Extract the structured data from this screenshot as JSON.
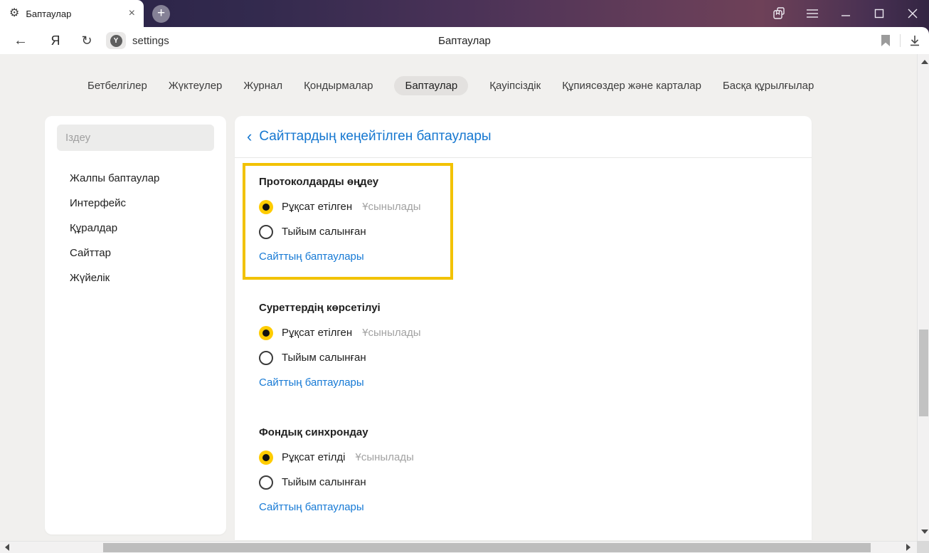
{
  "window": {
    "tab_title": "Баптаулар"
  },
  "toolbar": {
    "url": "settings",
    "page_title": "Баптаулар",
    "protect_letter": "Y"
  },
  "icons": {
    "gear": "⚙",
    "close": "×",
    "plus": "+",
    "back_arrow": "←",
    "refresh": "↻",
    "ya_logo": "Я",
    "back_chevron": "‹"
  },
  "nav": {
    "items": [
      {
        "label": "Бетбелгілер",
        "selected": false
      },
      {
        "label": "Жүктеулер",
        "selected": false
      },
      {
        "label": "Журнал",
        "selected": false
      },
      {
        "label": "Қондырмалар",
        "selected": false
      },
      {
        "label": "Баптаулар",
        "selected": true
      },
      {
        "label": "Қауіпсіздік",
        "selected": false
      },
      {
        "label": "Құпиясөздер және карталар",
        "selected": false
      },
      {
        "label": "Басқа құрылғылар",
        "selected": false
      }
    ]
  },
  "sidebar": {
    "search_placeholder": "Іздеу",
    "items": [
      {
        "label": "Жалпы баптаулар"
      },
      {
        "label": "Интерфейс"
      },
      {
        "label": "Құралдар"
      },
      {
        "label": "Сайттар"
      },
      {
        "label": "Жүйелік"
      }
    ]
  },
  "main": {
    "header": "Сайттардың кеңейтілген баптаулары",
    "sections": [
      {
        "title": "Протоколдарды өңдеу",
        "highlighted": true,
        "options": [
          {
            "label": "Рұқсат етілген",
            "selected": true,
            "badge": "Ұсынылады"
          },
          {
            "label": "Тыйым салынған",
            "selected": false,
            "badge": ""
          }
        ],
        "link": "Сайттың баптаулары"
      },
      {
        "title": "Суреттердің көрсетілуі",
        "highlighted": false,
        "options": [
          {
            "label": "Рұқсат етілген",
            "selected": true,
            "badge": "Ұсынылады"
          },
          {
            "label": "Тыйым салынған",
            "selected": false,
            "badge": ""
          }
        ],
        "link": "Сайттың баптаулары"
      },
      {
        "title": "Фондық синхрондау",
        "highlighted": false,
        "options": [
          {
            "label": "Рұқсат етілді",
            "selected": true,
            "badge": "Ұсынылады"
          },
          {
            "label": "Тыйым салынған",
            "selected": false,
            "badge": ""
          }
        ],
        "link": "Сайттың баптаулары"
      }
    ]
  },
  "colors": {
    "highlight_border": "#f2c200",
    "radio_selected": "#ffcc00",
    "link_blue": "#177ad5",
    "header_blue": "#1577d0",
    "page_bg": "#f1f0ee"
  }
}
